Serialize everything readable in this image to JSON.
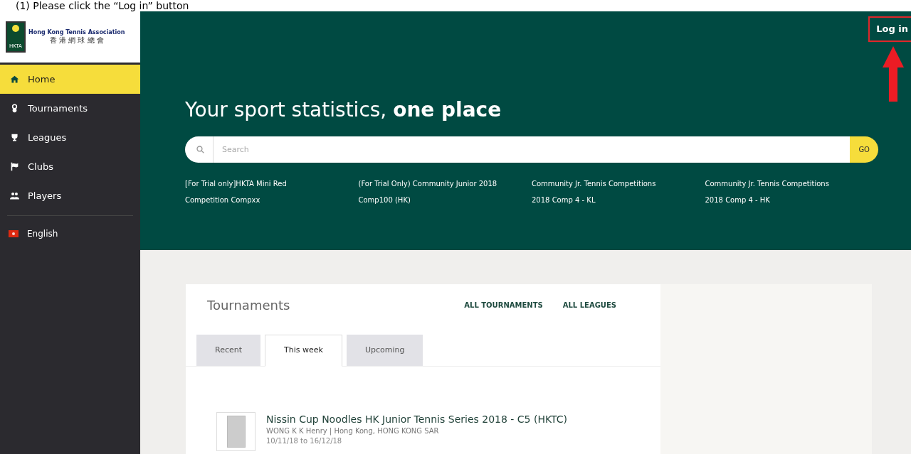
{
  "caption": "(1)  Please click the “Log in” button",
  "logo": {
    "name": "Hong Kong Tennis Association",
    "name_zh": "香 港 網 球 總 會",
    "mark": "HKTA"
  },
  "sidebar": {
    "items": [
      {
        "label": "Home",
        "kind": "home",
        "selected": true
      },
      {
        "label": "Tournaments",
        "kind": "tournaments",
        "selected": false
      },
      {
        "label": "Leagues",
        "kind": "leagues",
        "selected": false
      },
      {
        "label": "Clubs",
        "kind": "clubs",
        "selected": false
      },
      {
        "label": "Players",
        "kind": "players",
        "selected": false
      }
    ],
    "language": "English"
  },
  "header": {
    "login": "Log in",
    "login_highlighted": true,
    "title": "Your sport statistics, **one place**",
    "search": {
      "placeholder": "Search",
      "button": "GO"
    },
    "quick_links": [
      [
        "[For Trial only]HKTA Mini Red",
        "Competition Compxx"
      ],
      [
        "(For Trial Only) Community Junior 2018",
        "Comp100 (HK)"
      ],
      [
        "Community Jr. Tennis Competitions",
        "2018 Comp 4 - KL"
      ],
      [
        "Community Jr. Tennis Competitions",
        "2018 Comp 4 - HK"
      ]
    ]
  },
  "tournaments": {
    "title": "Tournaments",
    "links": [
      "ALL TOURNAMENTS",
      "ALL LEAGUES"
    ],
    "tabs": [
      {
        "label": "Recent",
        "selected": false
      },
      {
        "label": "This week",
        "selected": true
      },
      {
        "label": "Upcoming",
        "selected": false
      }
    ],
    "items": [
      {
        "name": "Nissin Cup Noodles HK Junior Tennis Series 2018 - C5 (HKTC)",
        "organizer": "WONG K K Henry | Hong Kong, HONG KONG SAR",
        "dates": "10/11/18 to 16/12/18"
      }
    ]
  }
}
